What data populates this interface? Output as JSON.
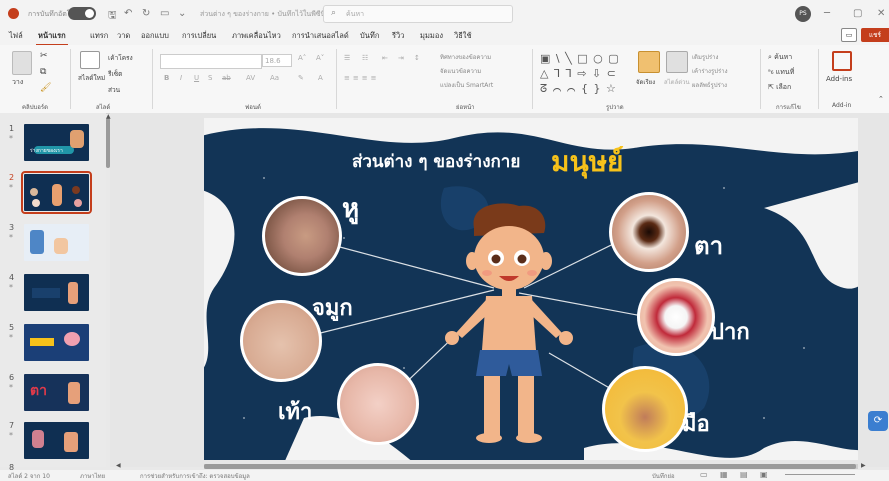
{
  "titlebar": {
    "autosave_label": "การบันทึกอัตโนมัติ",
    "filename": "ส่วนต่าง ๆ ของร่างกาย • บันทึกไว้ในพีซีนี้",
    "search_placeholder": "ค้นหา",
    "avatar_initials": "PS"
  },
  "tabs": [
    "ไฟล์",
    "หน้าแรก",
    "แทรก",
    "วาด",
    "ออกแบบ",
    "การเปลี่ยน",
    "ภาพเคลื่อนไหว",
    "การนำเสนอสไลด์",
    "บันทึก",
    "รีวิว",
    "มุมมอง",
    "วิธีใช้"
  ],
  "share_label": "แชร์",
  "ribbon": {
    "clipboard": {
      "label": "คลิปบอร์ด",
      "paste": "วาง"
    },
    "slides": {
      "label": "สไลด์",
      "new_slide": "สไลด์ใหม่",
      "layout": "เค้าโครง",
      "reset": "รีเซ็ต",
      "section": "ส่วน"
    },
    "font": {
      "label": "ฟอนต์",
      "size": "18.6"
    },
    "paragraph": {
      "label": "ย่อหน้า",
      "text_direction": "ทิศทางของข้อความ",
      "align_text": "จัดแนวข้อความ",
      "smartart": "แปลงเป็น SmartArt"
    },
    "drawing": {
      "label": "รูปวาด",
      "arrange": "จัดเรียง",
      "quick_styles": "สไตล์ด่วน",
      "fill": "เติมรูปร่าง",
      "outline": "เค้าร่างรูปร่าง",
      "effects": "ผลลัพธ์รูปร่าง"
    },
    "editing": {
      "label": "การแก้ไข",
      "find": "ค้นหา",
      "replace": "แทนที่",
      "select": "เลือก"
    },
    "addins": {
      "label": "Add-in",
      "button": "Add-ins"
    }
  },
  "thumbnails": [
    {
      "num": "1",
      "text": "ร่างกายของเรา"
    },
    {
      "num": "2",
      "text": ""
    },
    {
      "num": "3",
      "text": ""
    },
    {
      "num": "4",
      "text": ""
    },
    {
      "num": "5",
      "text": ""
    },
    {
      "num": "6",
      "text": "ตา"
    },
    {
      "num": "7",
      "text": ""
    },
    {
      "num": "8",
      "text": ""
    }
  ],
  "slide": {
    "title": "ส่วนต่าง ๆ ของร่างกาย",
    "title_big": "มนุษย์",
    "parts": {
      "ear": "หู",
      "nose": "จมูก",
      "foot": "เท้า",
      "eye": "ตา",
      "mouth": "ปาก",
      "hand": "มือ"
    }
  },
  "status": {
    "slide_info": "สไลด์ 2 จาก 10",
    "language": "ภาษาไทย",
    "accessibility": "การช่วยสำหรับการเข้าถึง: ตรวจสอบข้อมูล",
    "notes": "บันทึกย่อ"
  },
  "colors": {
    "accent": "#c43e1c",
    "slide_bg": "#123456",
    "title_big": "#f7c21a"
  }
}
